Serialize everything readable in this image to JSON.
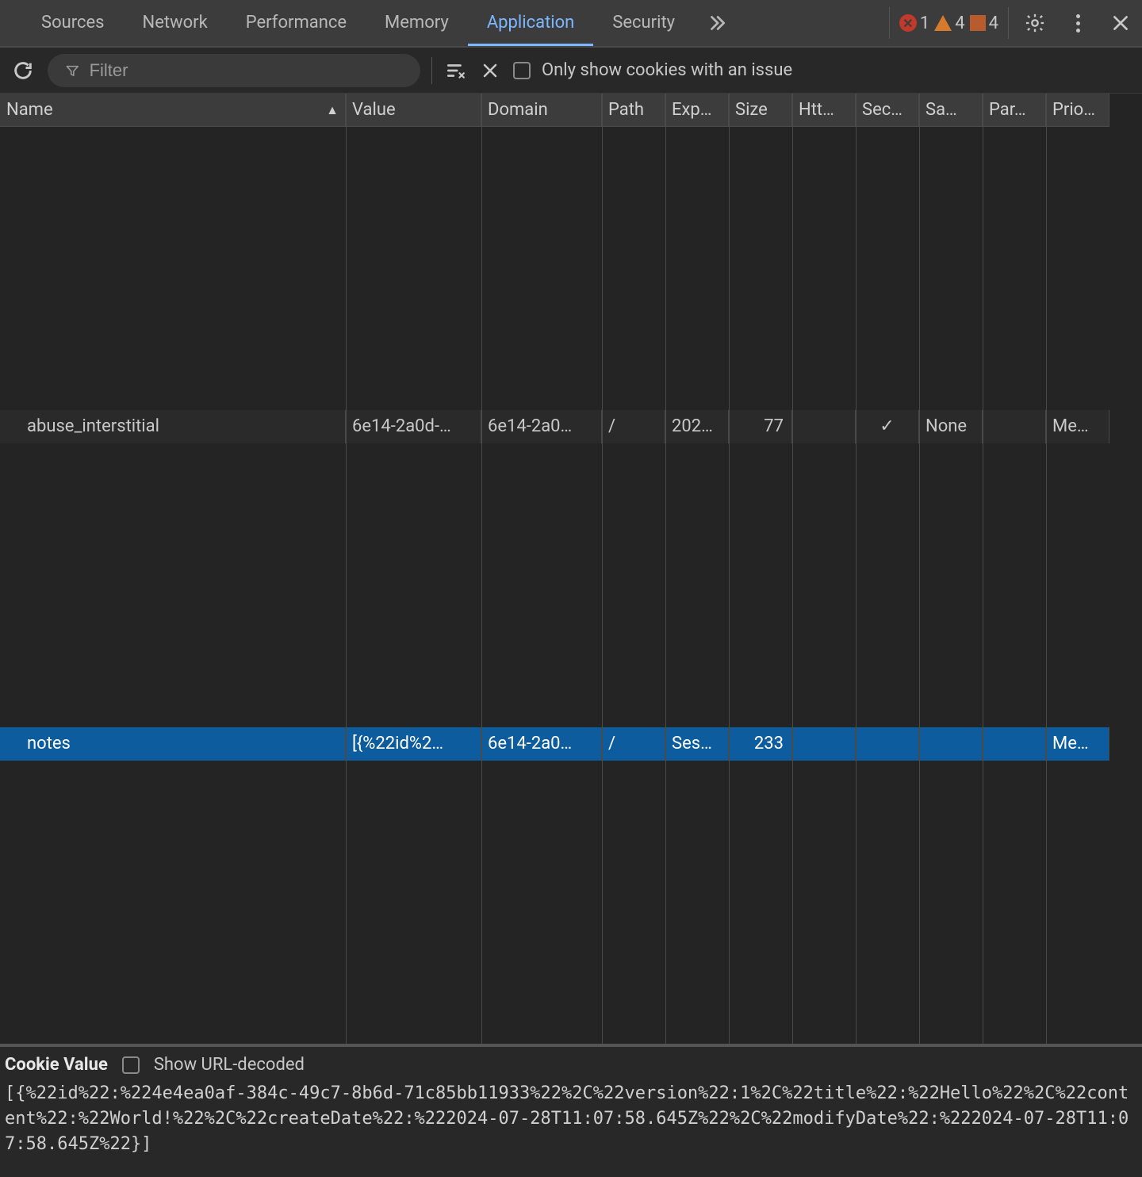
{
  "tabs": {
    "items": [
      {
        "label": "Sources",
        "active": false
      },
      {
        "label": "Network",
        "active": false
      },
      {
        "label": "Performance",
        "active": false
      },
      {
        "label": "Memory",
        "active": false
      },
      {
        "label": "Application",
        "active": true
      },
      {
        "label": "Security",
        "active": false
      }
    ]
  },
  "status": {
    "errors": "1",
    "warnings": "4",
    "issues": "4"
  },
  "toolbar": {
    "filter_placeholder": "Filter",
    "only_issues_label": "Only show cookies with an issue"
  },
  "table": {
    "headers": {
      "name": "Name",
      "value": "Value",
      "domain": "Domain",
      "path": "Path",
      "expires": "Exp…",
      "size": "Size",
      "httponly": "Htt…",
      "secure": "Sec…",
      "samesite": "Sa…",
      "partition": "Par…",
      "priority": "Prio…"
    },
    "rows": [
      {
        "name": "abuse_interstitial",
        "value": "6e14-2a0d-…",
        "domain": "6e14-2a0…",
        "path": "/",
        "expires": "202…",
        "size": "77",
        "httponly": "",
        "secure": "✓",
        "samesite": "None",
        "partition": "",
        "priority": "Me…",
        "selected": false
      },
      {
        "name": "notes",
        "value": "[{%22id%2…",
        "domain": "6e14-2a0…",
        "path": "/",
        "expires": "Ses…",
        "size": "233",
        "httponly": "",
        "secure": "",
        "samesite": "",
        "partition": "",
        "priority": "Me…",
        "selected": true
      }
    ]
  },
  "cookie_detail": {
    "title": "Cookie Value",
    "decode_label": "Show URL-decoded",
    "body": "[{%22id%22:%224e4ea0af-384c-49c7-8b6d-71c85bb11933%22%2C%22version%22:1%2C%22title%22:%22Hello%22%2C%22content%22:%22World!%22%2C%22createDate%22:%222024-07-28T11:07:58.645Z%22%2C%22modifyDate%22:%222024-07-28T11:07:58.645Z%22}]"
  }
}
